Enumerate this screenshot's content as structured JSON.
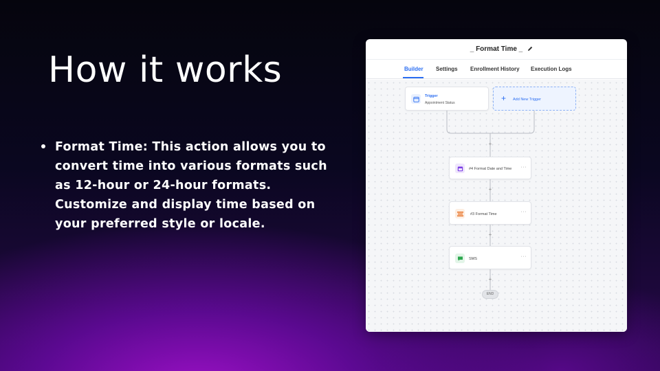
{
  "slide": {
    "title": "How it works",
    "bullet_lines": [
      "Format Time: This action allows you to",
      "convert time into various formats such",
      "as 12-hour or 24-hour formats.",
      "Customize and display time based on",
      "your preferred style or locale."
    ]
  },
  "workflow": {
    "title": "_ Format Time _",
    "tabs": [
      "Builder",
      "Settings",
      "Enrollment History",
      "Execution Logs"
    ],
    "active_tab": "Builder",
    "trigger": {
      "title": "Trigger",
      "subtitle": "Appointment Status"
    },
    "add_trigger_label": "Add New Trigger",
    "steps": [
      {
        "label": "#4 Format Date and Time",
        "icon": "calendar-icon",
        "color": "#7b3fe4"
      },
      {
        "label": "#3 Format Time",
        "icon": "format-time-icon",
        "color": "#e8742a"
      },
      {
        "label": "SMS",
        "icon": "sms-icon",
        "color": "#2ea84f"
      }
    ],
    "more_symbol": "···",
    "plus_symbol": "+",
    "end_label": "END"
  },
  "colors": {
    "accent": "#2b6ef2",
    "background": "#0a0720",
    "glow": "#9a10c4"
  }
}
